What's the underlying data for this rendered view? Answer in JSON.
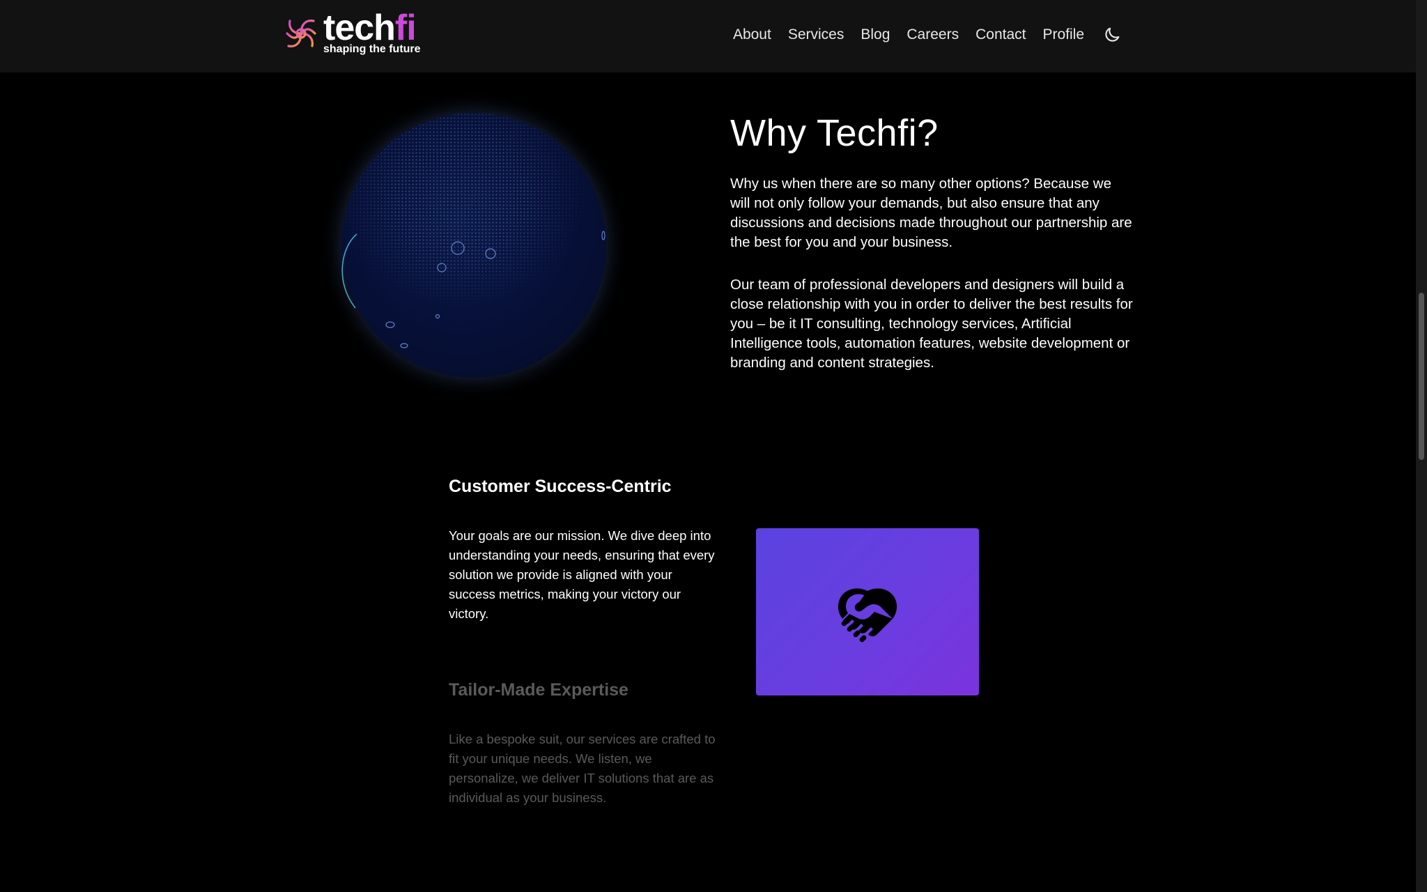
{
  "brand": {
    "name_part1": "tech",
    "name_part2": "fi",
    "tagline": "shaping the future",
    "accent": "#c94bd6"
  },
  "nav": {
    "links": [
      "About",
      "Services",
      "Blog",
      "Careers",
      "Contact",
      "Profile"
    ],
    "theme_icon": "moon-icon"
  },
  "why": {
    "title": "Why Techfi?",
    "p1": "Why us when there are so many other options? Because we will not only follow your demands, but also ensure that any discussions and decisions made throughout our partnership are the best for you and your business.",
    "p2": "Our team of professional developers and designers will build a close relationship with you in order to deliver the best results for you – be it IT consulting, technology services, Artificial Intelligence tools, automation features, website development or branding and content strategies."
  },
  "features": [
    {
      "title": "Customer Success-Centric",
      "text": "Your goals are our mission. We dive deep into understanding your needs, ensuring that every solution we provide is aligned with your success metrics, making your victory our victory.",
      "active": true
    },
    {
      "title": "Tailor-Made Expertise",
      "text": "Like a bespoke suit, our services are crafted to fit your unique needs. We listen, we personalize, we deliver IT solutions that are as individual as your business.",
      "active": false
    }
  ],
  "feature_card": {
    "icon": "handshake-icon",
    "gradient_start": "#5a43e0",
    "gradient_end": "#7b33dd"
  },
  "colors": {
    "background": "#000000",
    "nav_background": "#121212",
    "inactive_text": "#5a5a5a"
  }
}
